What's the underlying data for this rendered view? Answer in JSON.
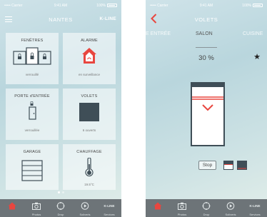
{
  "status_bar": {
    "carrier": "••••• Carrier",
    "time": "9:41 AM",
    "battery": "100%"
  },
  "home": {
    "title": "NANTES",
    "logo": "K-LINE",
    "tiles": [
      {
        "title": "FENÊTRES",
        "status": "verrouillé"
      },
      {
        "title": "ALARME",
        "status": "en surveillance"
      },
      {
        "title": "PORTE d'ENTRÉE",
        "status": "verrouillée"
      },
      {
        "title": "VOLETS",
        "status": "6 ouverts"
      },
      {
        "title": "GARAGE",
        "status": ""
      },
      {
        "title": "CHAUFFAGE",
        "status": "19.5°C"
      }
    ],
    "page_dots": 2,
    "active_dot": 0
  },
  "tabbar": {
    "items": [
      {
        "label": "",
        "icon": "home-icon"
      },
      {
        "label": "Photos",
        "icon": "camera-icon"
      },
      {
        "label": "Drop",
        "icon": "compass-icon"
      },
      {
        "label": "Soliveris",
        "icon": "play-icon"
      },
      {
        "label": "Services",
        "icon": "kline-logo"
      }
    ]
  },
  "volets": {
    "title": "VOLETS",
    "rooms": [
      "E ENTRÉE",
      "SALON",
      "CUISINE"
    ],
    "selected_room": 1,
    "percent": "30 %",
    "opening_fraction": 0.3,
    "stop_label": "Stop"
  },
  "colors": {
    "accent": "#e8463f",
    "tile_bg": "rgba(255,255,255,0.55)",
    "tabbar": "#6d7478",
    "dark_icon": "#3f4e57"
  }
}
